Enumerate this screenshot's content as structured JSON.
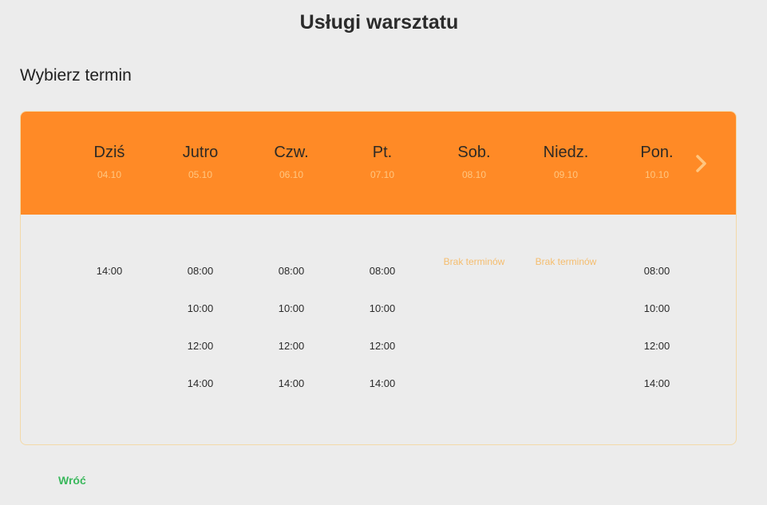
{
  "page": {
    "title": "Usługi warsztatu",
    "subtitle": "Wybierz termin",
    "back_label": "Wróć"
  },
  "calendar": {
    "days": [
      {
        "name": "Dziś",
        "date": "04.10",
        "slots": [
          "14:00"
        ],
        "no_slots_label": ""
      },
      {
        "name": "Jutro",
        "date": "05.10",
        "slots": [
          "08:00",
          "10:00",
          "12:00",
          "14:00"
        ],
        "no_slots_label": ""
      },
      {
        "name": "Czw.",
        "date": "06.10",
        "slots": [
          "08:00",
          "10:00",
          "12:00",
          "14:00"
        ],
        "no_slots_label": ""
      },
      {
        "name": "Pt.",
        "date": "07.10",
        "slots": [
          "08:00",
          "10:00",
          "12:00",
          "14:00"
        ],
        "no_slots_label": ""
      },
      {
        "name": "Sob.",
        "date": "08.10",
        "slots": [],
        "no_slots_label": "Brak terminów"
      },
      {
        "name": "Niedz.",
        "date": "09.10",
        "slots": [],
        "no_slots_label": "Brak terminów"
      },
      {
        "name": "Pon.",
        "date": "10.10",
        "slots": [
          "08:00",
          "10:00",
          "12:00",
          "14:00"
        ],
        "no_slots_label": ""
      }
    ],
    "next_icon": "chevron-right-icon"
  },
  "colors": {
    "header_bg": "#ff8a26",
    "accent_light": "#ffc680",
    "no_slots": "#f5bd6e",
    "back_link": "#3ab85c",
    "background": "#ececec"
  }
}
